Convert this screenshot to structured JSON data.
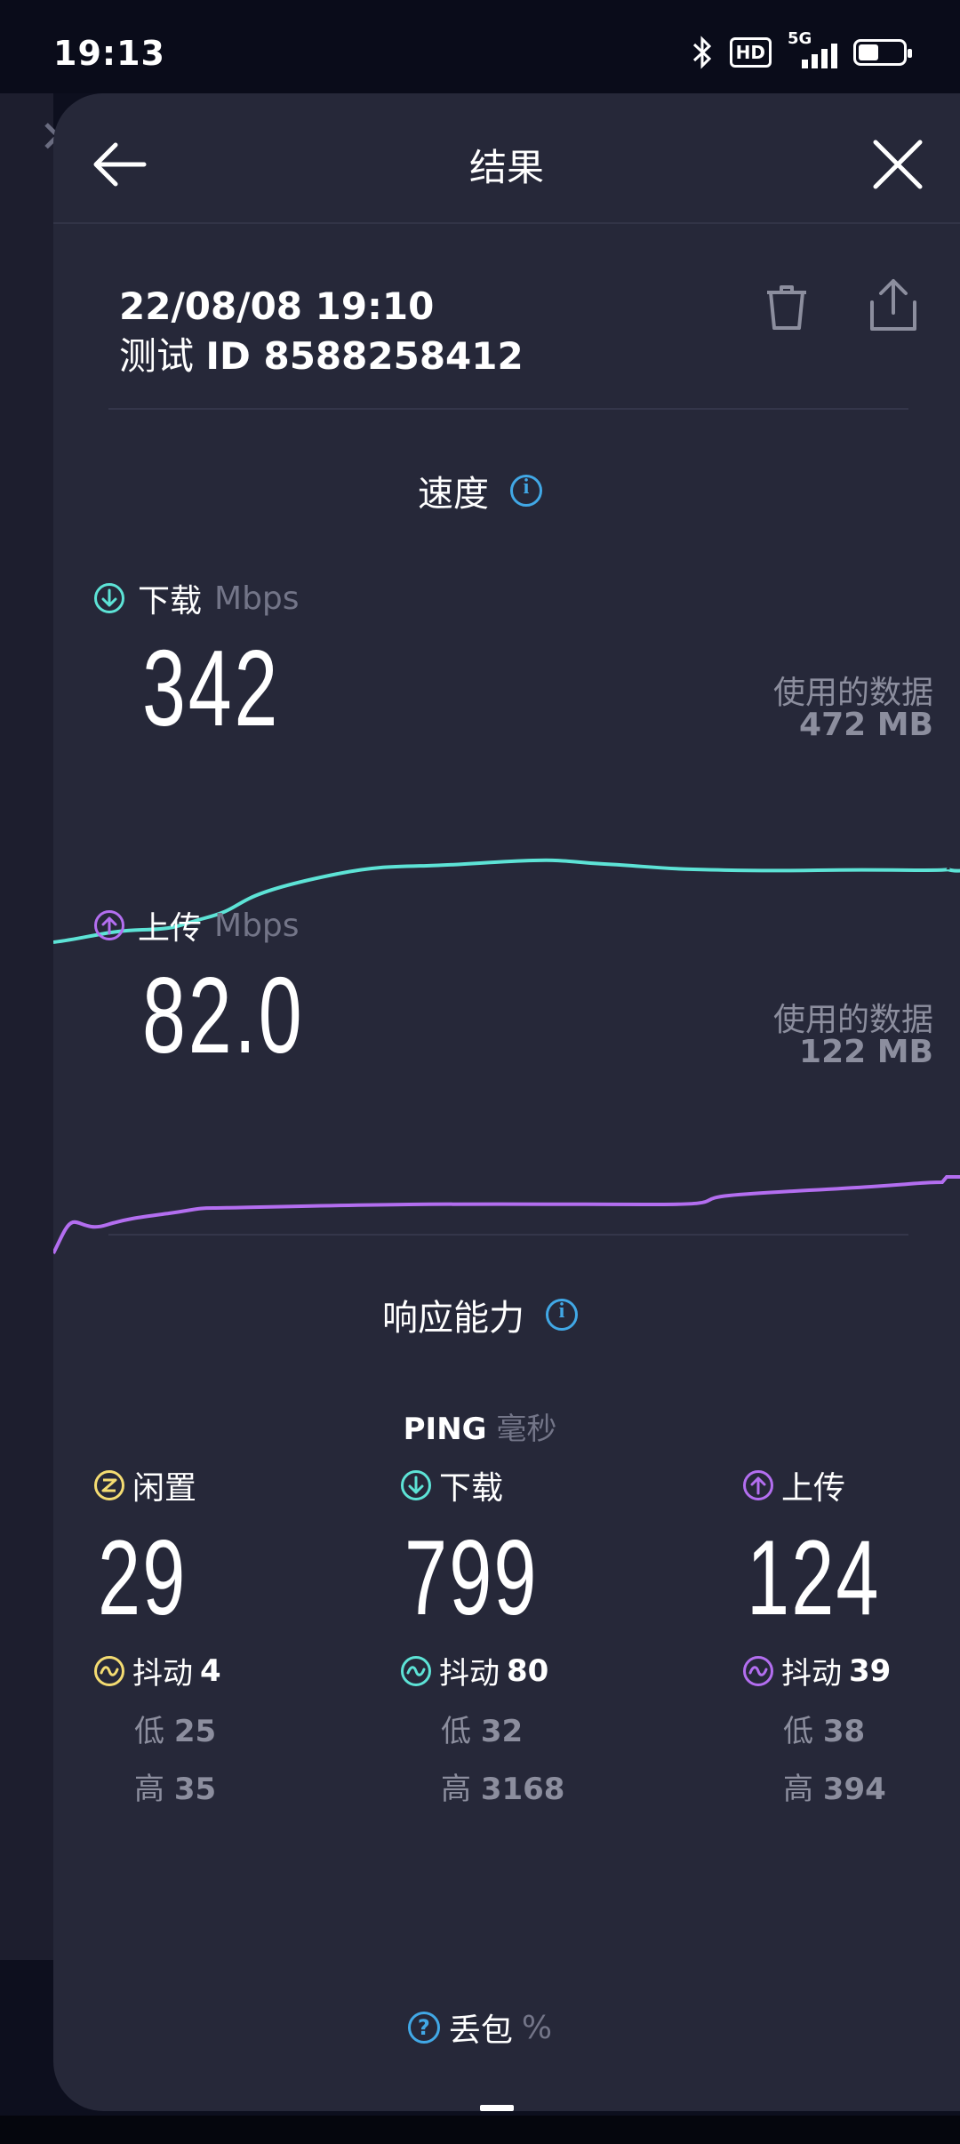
{
  "status_bar": {
    "time": "19:13",
    "hd": "HD",
    "network": "5G",
    "battery_level": 0.45
  },
  "header": {
    "title": "结果"
  },
  "test": {
    "datetime": "22/08/08 19:10",
    "id_label": "测试",
    "id": "ID 8588258412"
  },
  "speed": {
    "section_title": "速度",
    "download": {
      "label": "下载",
      "unit": "Mbps",
      "value": "342",
      "data_label": "使用的数据",
      "data_value": "472 MB"
    },
    "upload": {
      "label": "上传",
      "unit": "Mbps",
      "value": "82.0",
      "data_label": "使用的数据",
      "data_value": "122 MB"
    }
  },
  "responsiveness": {
    "section_title": "响应能力",
    "ping_label": "PING",
    "ping_unit": "毫秒",
    "idle": {
      "label": "闲置",
      "value": "29",
      "jitter_label": "抖动",
      "jitter": "4",
      "low_label": "低",
      "low": "25",
      "high_label": "高",
      "high": "35"
    },
    "download": {
      "label": "下载",
      "value": "799",
      "jitter_label": "抖动",
      "jitter": "80",
      "low_label": "低",
      "low": "32",
      "high_label": "高",
      "high": "3168"
    },
    "upload": {
      "label": "上传",
      "value": "124",
      "jitter_label": "抖动",
      "jitter": "39",
      "low_label": "低",
      "low": "38",
      "high_label": "高",
      "high": "394"
    }
  },
  "packet_loss": {
    "label": "丢包",
    "unit": "%",
    "value": "—"
  },
  "colors": {
    "background": "#262839",
    "download": "#5de3d6",
    "upload": "#b36ef0",
    "idle": "#f4dc72",
    "info": "#41a8e6"
  },
  "icons": [
    "back-arrow-icon",
    "close-icon",
    "trash-icon",
    "share-icon",
    "info-icon",
    "download-arrow-icon",
    "upload-arrow-icon",
    "idle-icon",
    "jitter-icon",
    "help-icon"
  ]
}
